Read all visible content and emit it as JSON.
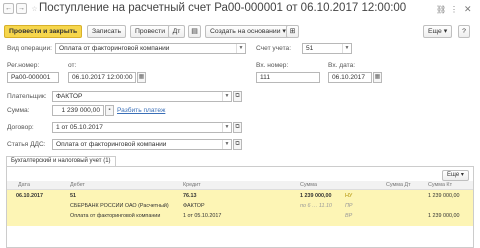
{
  "title": "Поступление на расчетный счет Ра00-000001 от 06.10.2017 12:00:00",
  "toolbar": {
    "post_close": "Провести и закрыть",
    "save": "Записать",
    "post": "Провести",
    "create_based": "Создать на основании",
    "more": "Еще",
    "help": "?"
  },
  "form": {
    "operation_label": "Вид операции:",
    "operation_value": "Оплата от факторинговой компании",
    "account_label": "Счет учета:",
    "account_value": "51",
    "regnum_label": "Рег.номер:",
    "regnum_value": "Ра00-000001",
    "from_label": "от:",
    "date_value": "06.10.2017 12:00:00",
    "in_num_label": "Вх. номер:",
    "in_num_value": "111",
    "in_date_label": "Вх. дата:",
    "in_date_value": "06.10.2017",
    "payer_label": "Плательщик:",
    "payer_value": "ФАКТОР",
    "sum_label": "Сумма:",
    "sum_value": "1 239 000,00",
    "split_link": "Разбить платеж",
    "contract_label": "Договор:",
    "contract_value": "1 от 05.10.2017",
    "dds_label": "Статья ДДС:",
    "dds_value": "Оплата от факторинговой компании"
  },
  "tab_label": "Бухгалтерский и налоговый учет (1)",
  "table": {
    "more": "Еще",
    "headers": [
      "Дата",
      "Дебет",
      "Кредит",
      "Сумма",
      "Сумма Дт",
      "Сумма Кт"
    ],
    "row": {
      "date": "06.10.2017",
      "debit_account": "51",
      "debit_sub1": "СБЕРБАНК РОССИИ ОАО (Расчетный)",
      "debit_sub2": "Оплата от факторинговой компании",
      "credit_account": "76.13",
      "credit_sub1": "ФАКТОР",
      "credit_sub2": "1 от 05.10.2017",
      "sum": "1 239 000,00",
      "sum_note": "по 6 … 11.10",
      "nu_label": "НУ",
      "pr_label": "ПР",
      "vr_label": "ВР",
      "sum_dt": "1 239 000,00",
      "sum_kt": "1 239 000,00"
    }
  },
  "colors": {
    "primary": "#f6d64c",
    "row": "#fdf5b5",
    "link": "#3a6fb7"
  }
}
